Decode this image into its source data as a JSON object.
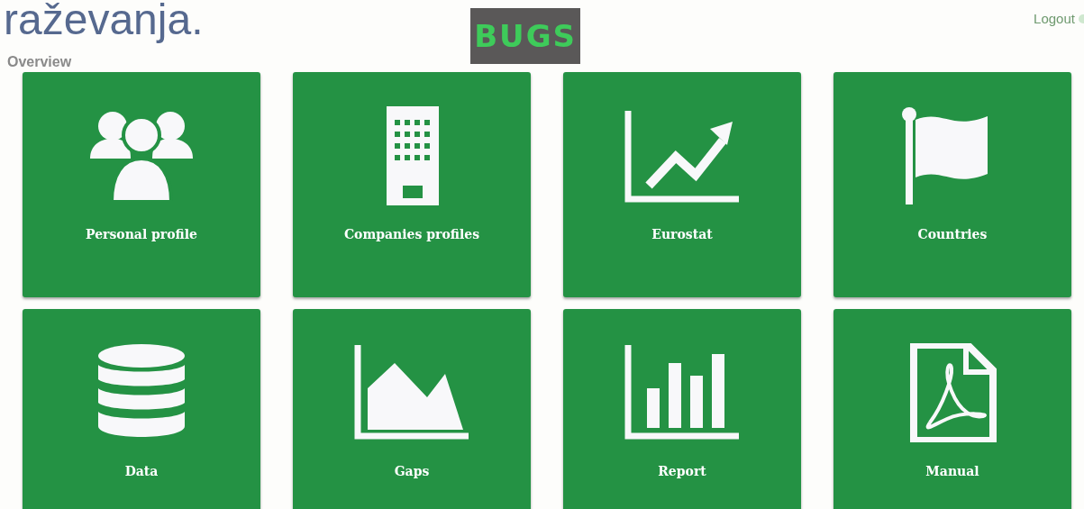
{
  "overlay_text": "raževanja.",
  "header": {
    "breadcrumb": "Overview",
    "logo": "BUGS",
    "logout": "Logout"
  },
  "tiles": [
    {
      "label": "Personal profile",
      "kind": "users"
    },
    {
      "label": "Companies profiles",
      "kind": "building"
    },
    {
      "label": "Eurostat",
      "kind": "trend"
    },
    {
      "label": "Countries",
      "kind": "flag"
    },
    {
      "label": "Data",
      "kind": "database"
    },
    {
      "label": "Gaps",
      "kind": "area"
    },
    {
      "label": "Report",
      "kind": "bars"
    },
    {
      "label": "Manual",
      "kind": "pdf"
    }
  ]
}
